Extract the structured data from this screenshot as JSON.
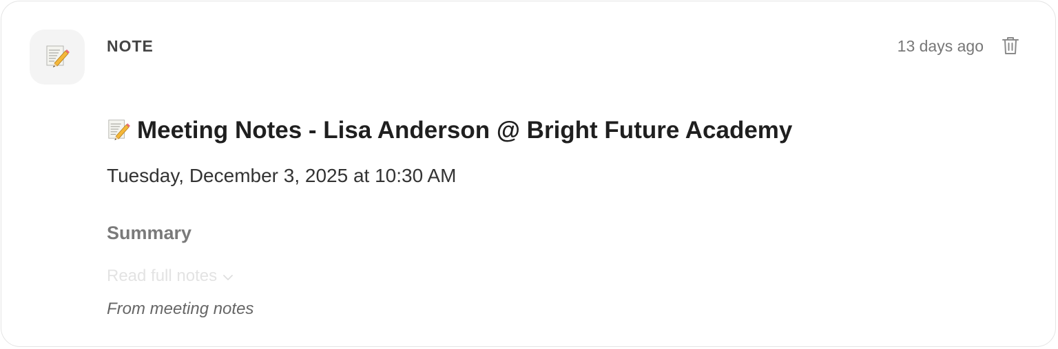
{
  "card": {
    "type_label": "NOTE",
    "timestamp": "13 days ago",
    "title": "Meeting Notes - Lisa Anderson @ Bright Future Academy",
    "date": "Tuesday, December 3, 2025 at 10:30 AM",
    "summary_heading": "Summary",
    "read_more_label": "Read full notes",
    "source": "From meeting notes",
    "icons": {
      "type": "memo-icon",
      "title": "memo-icon",
      "delete": "trash-icon",
      "expand": "chevron-down-icon"
    }
  }
}
